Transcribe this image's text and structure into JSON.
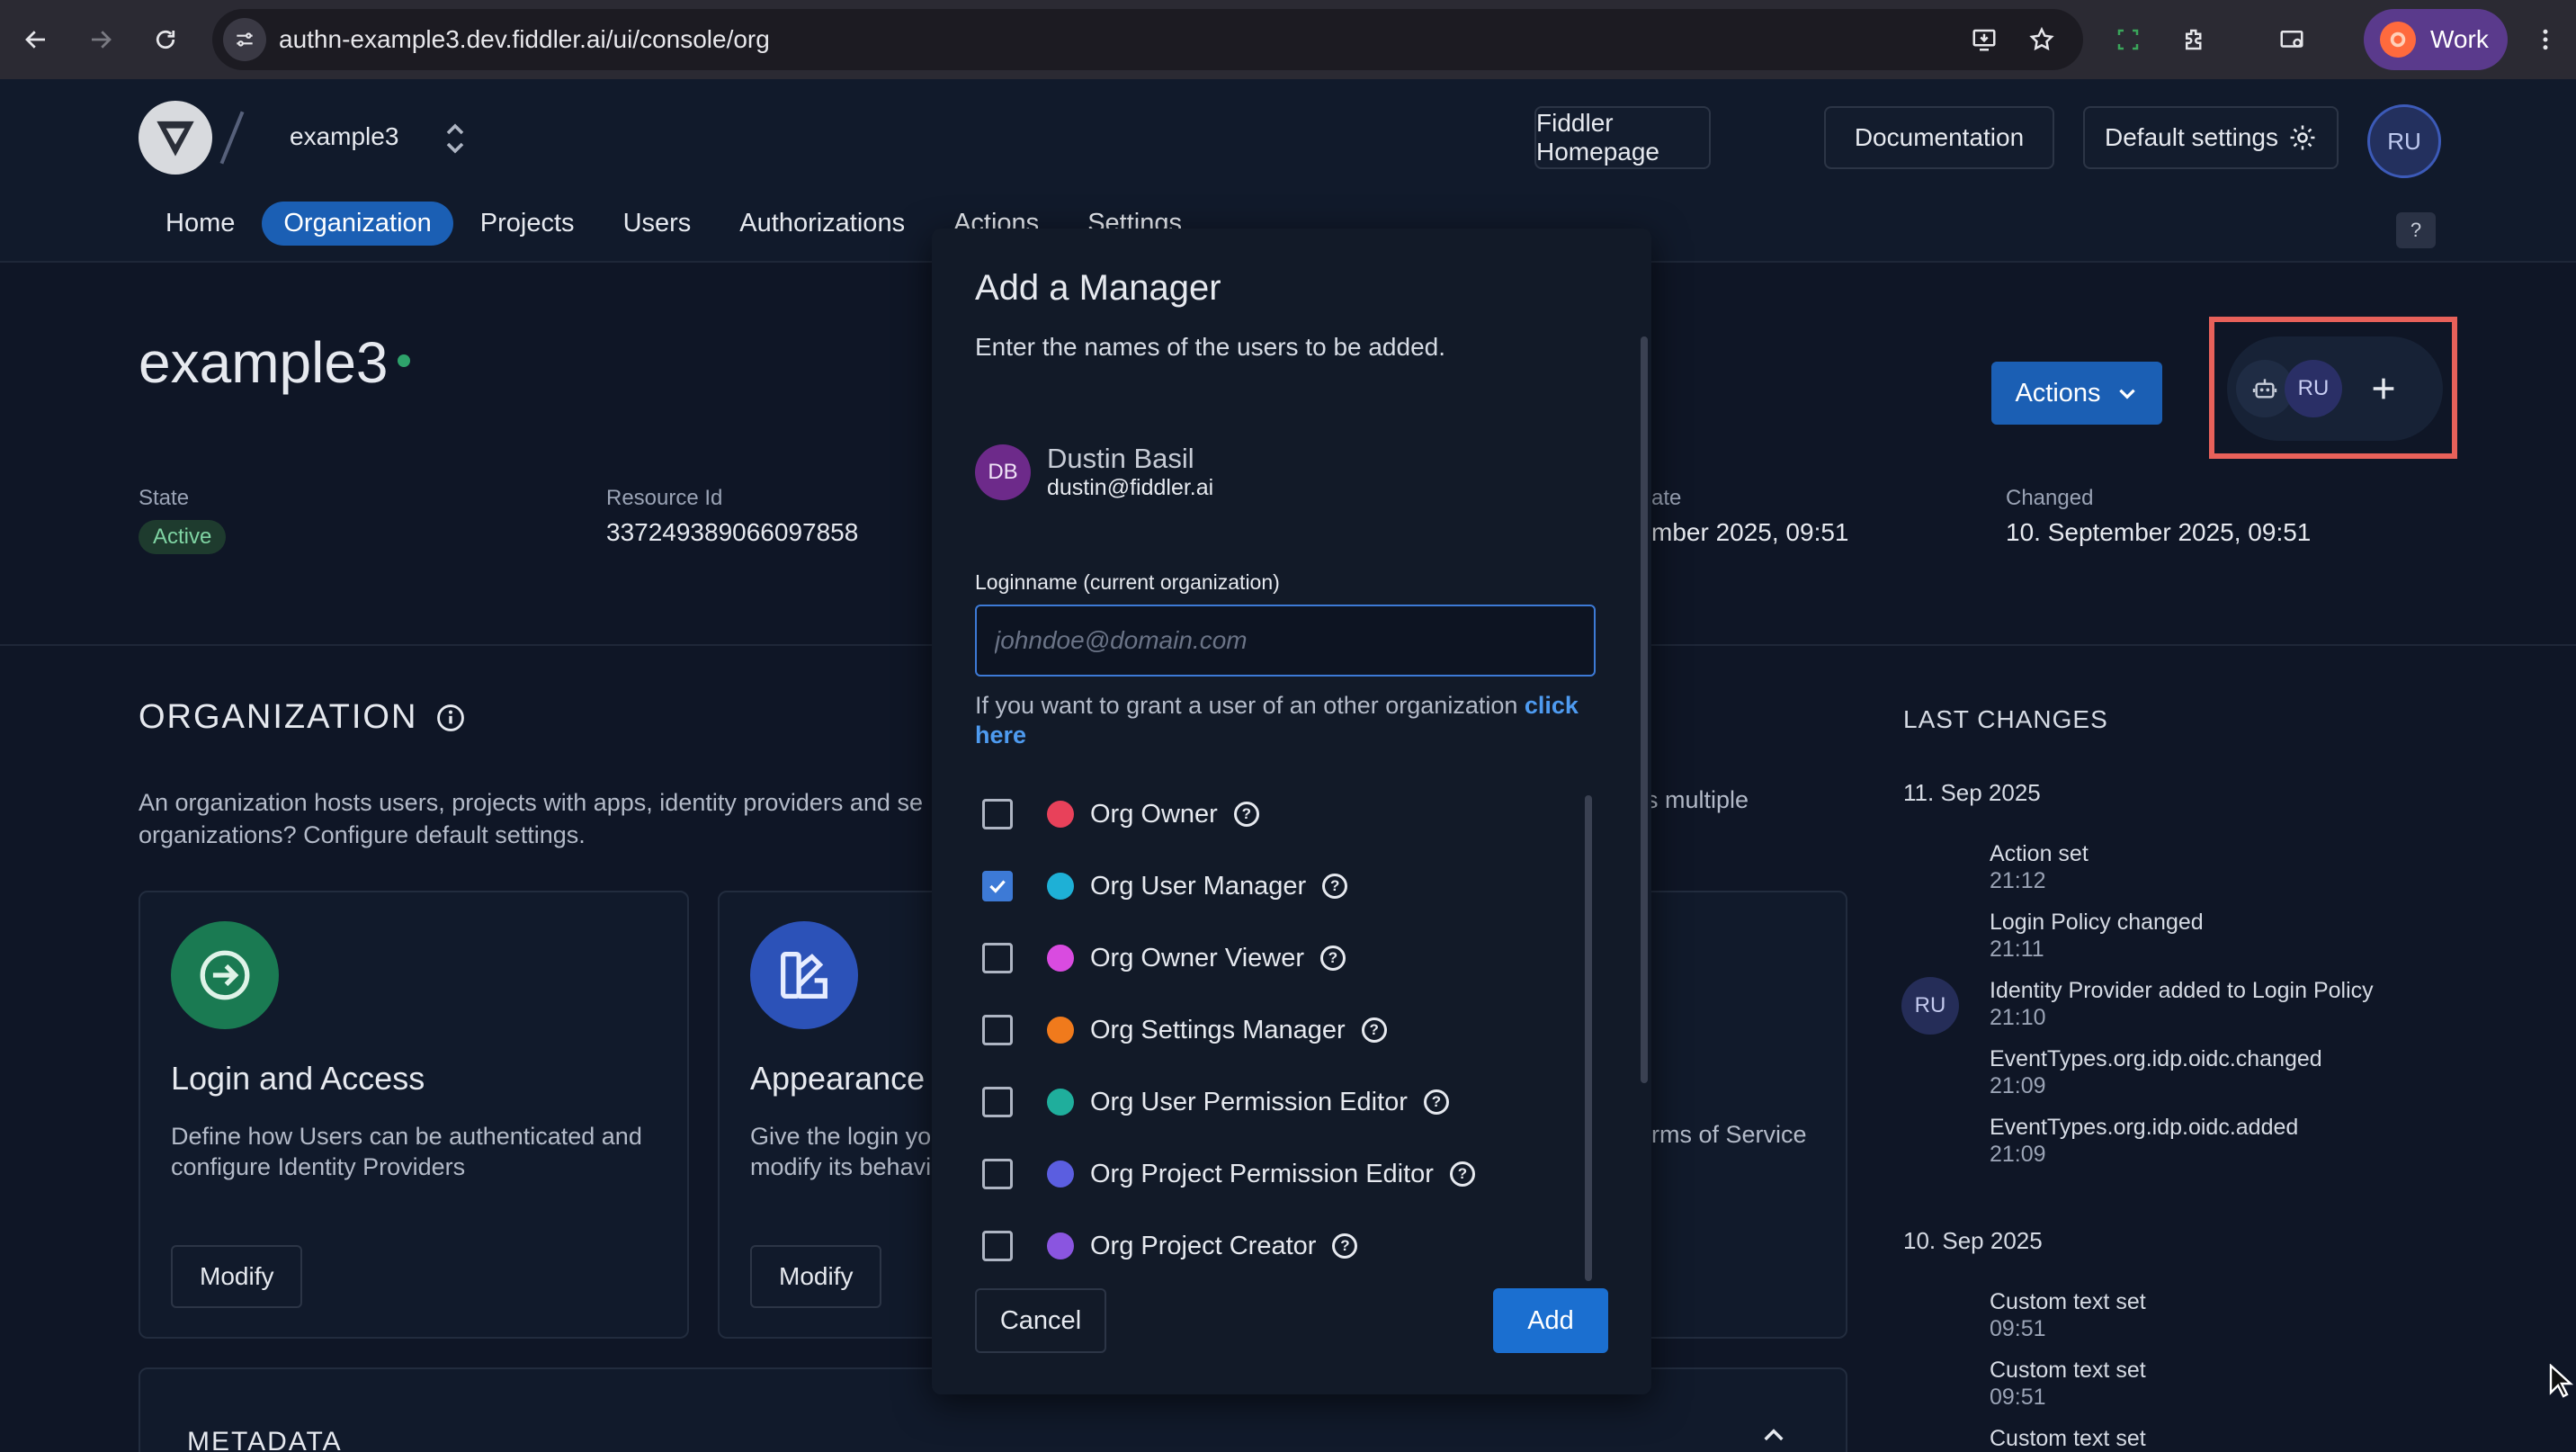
{
  "browser": {
    "url": "authn-example3.dev.fiddler.ai/ui/console/org",
    "profile_label": "Work"
  },
  "header": {
    "org_name": "example3",
    "buttons": {
      "homepage": "Fiddler Homepage",
      "documentation": "Documentation",
      "default_settings": "Default settings"
    },
    "user_initials": "RU",
    "help_label": "?"
  },
  "tabs": [
    {
      "label": "Home"
    },
    {
      "label": "Organization"
    },
    {
      "label": "Projects"
    },
    {
      "label": "Users"
    },
    {
      "label": "Authorizations"
    },
    {
      "label": "Actions"
    },
    {
      "label": "Settings"
    }
  ],
  "page": {
    "title": "example3",
    "actions_label": "Actions",
    "manager_initials": "RU",
    "meta": {
      "state_label": "State",
      "state_value": "Active",
      "resource_label": "Resource Id",
      "resource_value": "337249389066097858",
      "created_label_partial": "ate",
      "created_value_partial": "mber 2025, 09:51",
      "changed_label": "Changed",
      "changed_value": "10. September 2025, 09:51"
    },
    "section_title": "ORGANIZATION",
    "section_desc_1": "An organization hosts users, projects with apps, identity providers and se",
    "section_desc_1_end": "s multiple",
    "section_desc_2": "organizations? Configure default settings.",
    "cards": [
      {
        "title": "Login and Access",
        "desc": "Define how Users can be authenticated and configure Identity Providers",
        "button": "Modify"
      },
      {
        "title": "Appearance",
        "desc_1": "Give the login yo",
        "desc_2": "modify its behavi",
        "button": "Modify"
      }
    ],
    "terms_partial": "rms of Service",
    "metadata_title": "METADATA"
  },
  "last_changes": {
    "title": "LAST CHANGES",
    "groups": [
      {
        "date": "11. Sep 2025",
        "initials": "RU",
        "items": [
          {
            "text": "Action set",
            "time": "21:12"
          },
          {
            "text": "Login Policy changed",
            "time": "21:11"
          },
          {
            "text": "Identity Provider added to Login Policy",
            "time": "21:10"
          },
          {
            "text": "EventTypes.org.idp.oidc.changed",
            "time": "21:09"
          },
          {
            "text": "EventTypes.org.idp.oidc.added",
            "time": "21:09"
          }
        ]
      },
      {
        "date": "10. Sep 2025",
        "items": [
          {
            "text": "Custom text set",
            "time": "09:51"
          },
          {
            "text": "Custom text set",
            "time": "09:51"
          },
          {
            "text": "Custom text set",
            "time": ""
          }
        ]
      }
    ]
  },
  "modal": {
    "title": "Add a Manager",
    "subtitle": "Enter the names of the users to be added.",
    "selected_user": {
      "initials": "DB",
      "name": "Dustin Basil",
      "email": "dustin@fiddler.ai"
    },
    "field_label": "Loginname (current organization)",
    "placeholder": "johndoe@domain.com",
    "value": "",
    "hint_text": "If you want to grant a user of an other organization ",
    "hint_link": "click here",
    "roles": [
      {
        "name": "Org Owner",
        "checked": false,
        "color": "#e8415a"
      },
      {
        "name": "Org User Manager",
        "checked": true,
        "color": "#1eb0d6"
      },
      {
        "name": "Org Owner Viewer",
        "checked": false,
        "color": "#d94be0"
      },
      {
        "name": "Org Settings Manager",
        "checked": false,
        "color": "#f07a1c"
      },
      {
        "name": "Org User Permission Editor",
        "checked": false,
        "color": "#1fae9c"
      },
      {
        "name": "Org Project Permission Editor",
        "checked": false,
        "color": "#5b5ee0"
      },
      {
        "name": "Org Project Creator",
        "checked": false,
        "color": "#8a55e0"
      }
    ],
    "cancel_label": "Cancel",
    "add_label": "Add"
  }
}
